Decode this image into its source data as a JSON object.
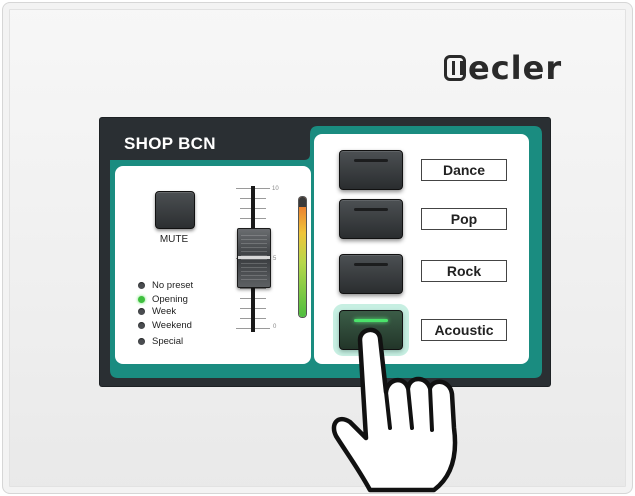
{
  "brand": {
    "logo_text": "ecler"
  },
  "screen": {
    "title": "SHOP BCN",
    "mute": {
      "label": "MUTE"
    },
    "presets": [
      {
        "label": "No preset",
        "active": false
      },
      {
        "label": "Opening",
        "active": true
      },
      {
        "label": "Week",
        "active": false
      },
      {
        "label": "Weekend",
        "active": false
      },
      {
        "label": "Special",
        "active": false
      }
    ],
    "fader": {
      "scale_top": "10",
      "scale_mid": "5",
      "scale_bottom": "0"
    },
    "music_buttons": [
      {
        "label": "Dance",
        "active": false
      },
      {
        "label": "Pop",
        "active": false
      },
      {
        "label": "Rock",
        "active": false
      },
      {
        "label": "Acoustic",
        "active": true
      }
    ]
  },
  "colors": {
    "bezel": "#2a2f33",
    "panel_accent": "#1a8c80",
    "led_on": "#3fbf3f",
    "active_button_glow": "#4be36b"
  }
}
